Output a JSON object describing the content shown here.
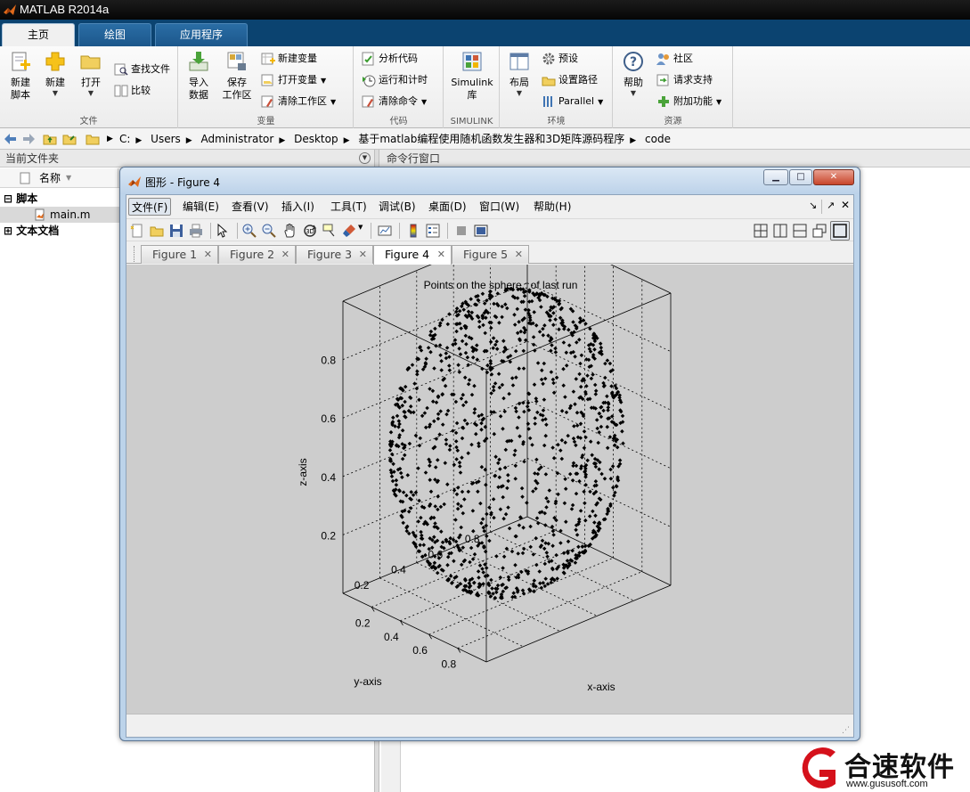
{
  "app": {
    "title": "MATLAB R2014a"
  },
  "ribbon": {
    "tabs": [
      "主页",
      "绘图",
      "应用程序"
    ],
    "groups": {
      "file": {
        "label": "文件",
        "new_script": [
          "新建",
          "脚本"
        ],
        "new": "新建",
        "open": "打开",
        "find_files": "查找文件",
        "compare": "比较"
      },
      "variable": {
        "label": "变量",
        "import": [
          "导入",
          "数据"
        ],
        "save": [
          "保存",
          "工作区"
        ],
        "new_variable": "新建变量",
        "open_variable": "打开变量",
        "clear_workspace": "清除工作区"
      },
      "code": {
        "label": "代码",
        "analyze": "分析代码",
        "run_time": "运行和计时",
        "clear_commands": "清除命令"
      },
      "simulink": {
        "label": "SIMULINK",
        "library": [
          "Simulink",
          "库"
        ]
      },
      "environment": {
        "label": "环境",
        "layout": "布局",
        "preferences": "预设",
        "set_path": "设置路径",
        "parallel": "Parallel"
      },
      "resources": {
        "label": "资源",
        "help": "帮助",
        "community": "社区",
        "request_support": "请求支持",
        "addons": "附加功能"
      }
    }
  },
  "address": {
    "crumbs": [
      "C:",
      "Users",
      "Administrator",
      "Desktop",
      "基于matlab编程使用随机函数发生器和3D矩阵源码程序",
      "code"
    ]
  },
  "panels": {
    "current_folder": {
      "title": "当前文件夹",
      "column": "名称",
      "tree": [
        {
          "label": "脚本",
          "kind": "group",
          "toggle": "⊟"
        },
        {
          "label": "main.m",
          "kind": "file"
        },
        {
          "label": "文本文档",
          "kind": "group",
          "toggle": "⊞"
        }
      ]
    },
    "command_window": {
      "title": "命令行窗口"
    }
  },
  "figure": {
    "window_title": "图形 - Figure 4",
    "menu": [
      "文件(F)",
      "编辑(E)",
      "查看(V)",
      "插入(I)",
      "工具(T)",
      "调试(B)",
      "桌面(D)",
      "窗口(W)",
      "帮助(H)"
    ],
    "tabs": [
      "Figure 1",
      "Figure 2",
      "Figure 3",
      "Figure 4",
      "Figure 5"
    ],
    "active_tab": "Figure 4"
  },
  "chart_data": {
    "type": "scatter",
    "title": "Points on the sphere : of last run",
    "xlabel": "x-axis",
    "ylabel": "y-axis",
    "zlabel": "z-axis",
    "x_ticks": [
      "0.2",
      "0.4",
      "0.6",
      "0.8"
    ],
    "y_ticks": [
      "0.2",
      "0.4",
      "0.6",
      "0.8"
    ],
    "z_ticks": [
      "0.2",
      "0.4",
      "0.6",
      "0.8"
    ],
    "xlim": [
      0,
      1
    ],
    "ylim": [
      0,
      1
    ],
    "zlim": [
      0,
      1
    ],
    "grid": true,
    "marker_color": "#000000",
    "description_of_points": "approx. 1200 random points uniformly distributed on the surface of a sphere centered at (0.5,0.5,0.5) with radius 0.5",
    "center": [
      0.5,
      0.5,
      0.5
    ],
    "radius": 0.5,
    "point_count": 1200
  },
  "watermark": {
    "text": "合速软件",
    "url": "www.gususoft.com"
  }
}
